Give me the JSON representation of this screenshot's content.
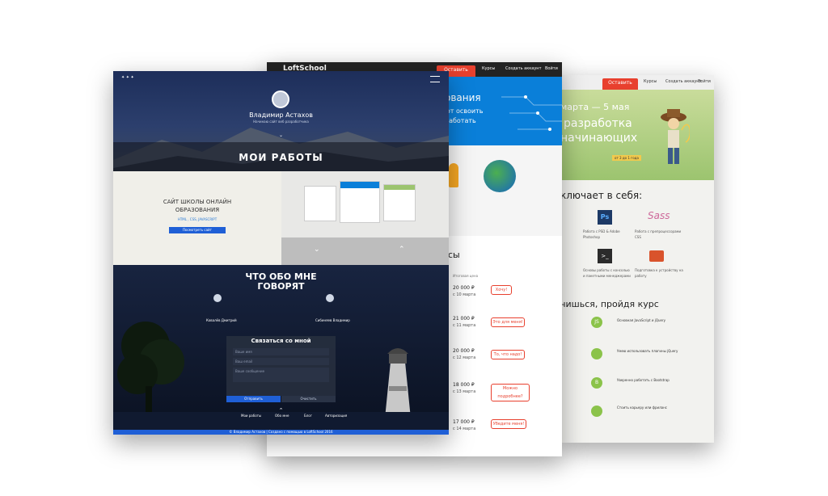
{
  "right_page": {
    "button": "Оставить заявку",
    "nav_courses": "Курсы",
    "nav_create": "Создать аккаунт",
    "nav_login": "Войти",
    "hero_title_1": "марта — 5 мая",
    "hero_title_2": "разработка",
    "hero_title_3": "начинающих",
    "hero_badge": "от 3 до 1 года",
    "includes_title": "ключает в себя:",
    "tools": [
      "Работа с PSD & Adobe Photoshop",
      "Работа с препроцессорами CSS",
      "Основы работы с консолью и пакетными менеджерами",
      "Подготовка к устройству на работу"
    ],
    "learn_title": "чишься, пройдя курс",
    "skills": [
      "Основная JavaScript и jQuery",
      "Умею использовать плагины jQuery",
      "Уверенно работать с Bootstrap",
      "Стоить карьеру или фриланс"
    ]
  },
  "middle_page": {
    "logo": "LoftSchool",
    "button": "Оставить заявку",
    "nav_courses": "Курсы",
    "nav_create": "Создать аккаунт",
    "nav_login": "Войти",
    "hero_1": "ования",
    "hero_2": "ют освоить",
    "hero_3": "работать",
    "section_title": "сы",
    "col_header": "Итоговая цена",
    "prices": [
      {
        "price": "20 000 ₽",
        "date": "с 10 марта",
        "btn": "Хочу!"
      },
      {
        "price": "21 000 ₽",
        "date": "с 11 марта",
        "btn": "Это для меня!"
      },
      {
        "price": "20 000 ₽",
        "date": "с 12 марта",
        "btn": "То, что надо!"
      },
      {
        "price": "18 000 ₽",
        "date": "с 13 марта",
        "btn": "Можно подробнее?"
      },
      {
        "price": "17 000 ₽",
        "date": "с 14 марта",
        "btn": "Убедите меня!"
      }
    ]
  },
  "left_page": {
    "name": "Владимир Астахов",
    "subtitle": "Начинаю сайт веб разработчика",
    "works_title": "МОИ РАБОТЫ",
    "project_title_1": "САЙТ ШКОЛЫ ОНЛАЙН",
    "project_title_2": "ОБРАЗОВАНИЯ",
    "project_tech": "HTML , CSS, JAVASCRIPT",
    "project_button": "Посмотреть сайт",
    "reviews_title_1": "ЧТО ОБО МНЕ",
    "reviews_title_2": "ГОВОРЯТ",
    "reviewer_1": "Ковалёв Дмитрий",
    "reviewer_2": "Сибиняев Владимир",
    "contact_title": "Связаться со мной",
    "field_name": "Ваше имя",
    "field_email": "Ваш email",
    "field_message": "Ваше сообщение",
    "send": "Отправить",
    "clear": "Очистить",
    "footer_links": [
      "Мои работы",
      "Обо мне",
      "Блог",
      "Авторизация"
    ],
    "copyright": "© Владимир Астахов | Создано с помощью в LoftSchool 2016"
  },
  "colors": {
    "accent_red": "#e8402e",
    "blue": "#0a7fd9",
    "navy": "#1b2a55"
  }
}
